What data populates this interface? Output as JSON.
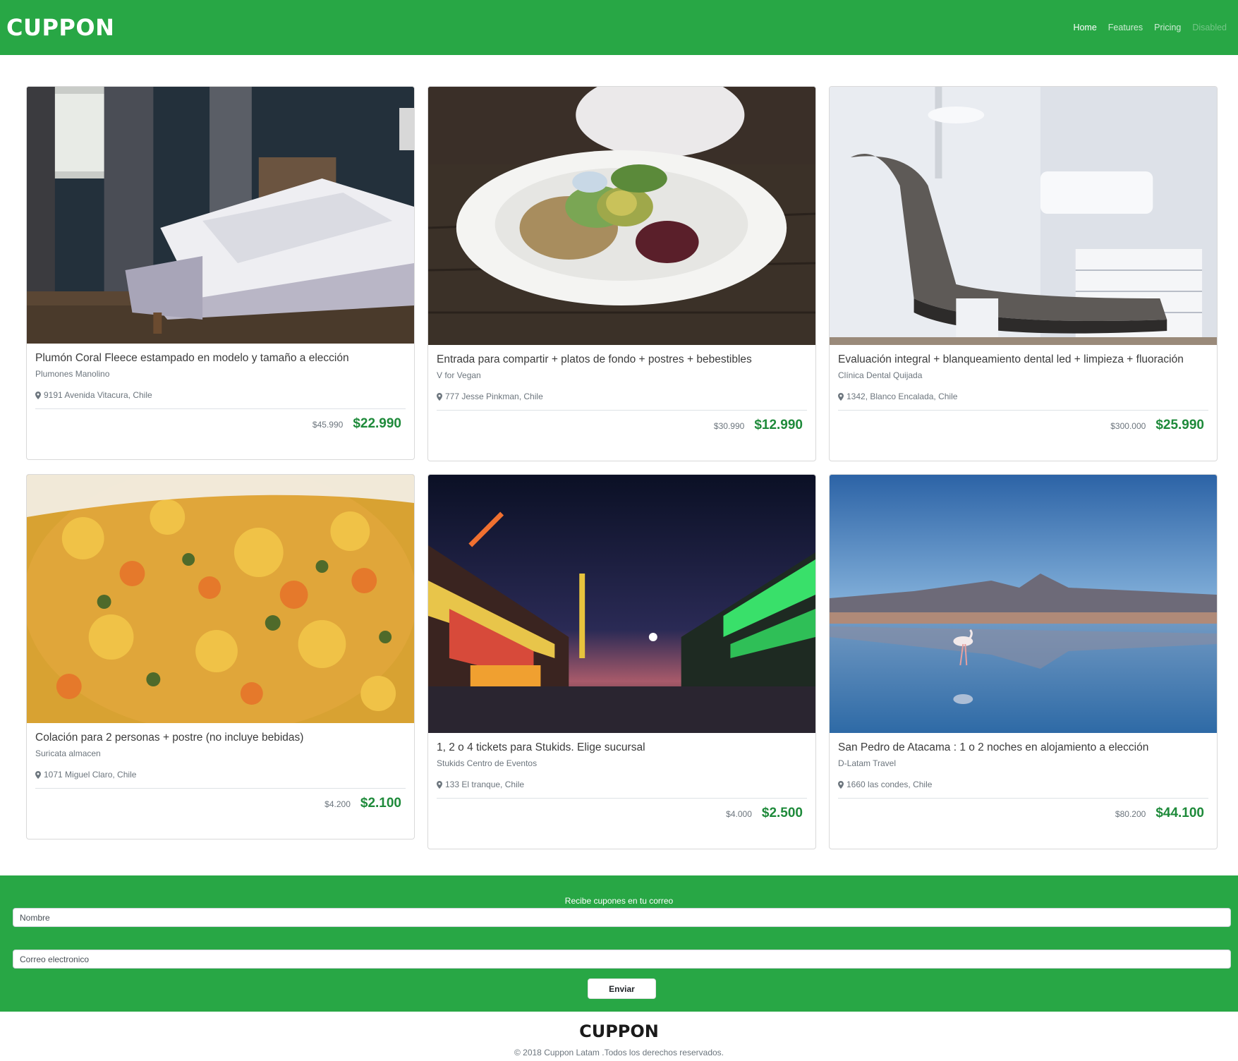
{
  "navbar": {
    "brand": "CUPPON",
    "links": [
      {
        "label": "Home",
        "state": "active"
      },
      {
        "label": "Features",
        "state": "normal"
      },
      {
        "label": "Pricing",
        "state": "normal"
      },
      {
        "label": "Disabled",
        "state": "disabled"
      }
    ]
  },
  "cards": [
    {
      "title": "Plumón Coral Fleece estampado en modelo y tamaño a elección",
      "seller": "Plumones Manolino",
      "location": "9191 Avenida Vitacura, Chile",
      "old_price": "$45.990",
      "new_price": "$22.990",
      "image": "bedroom-photo"
    },
    {
      "title": "Entrada para compartir + platos de fondo + postres + bebestibles",
      "seller": "V for Vegan",
      "location": "777 Jesse Pinkman, Chile",
      "old_price": "$30.990",
      "new_price": "$12.990",
      "image": "vegan-salad-photo"
    },
    {
      "title": "Evaluación integral + blanqueamiento dental led + limpieza + fluoración",
      "seller": "Clínica Dental Quijada",
      "location": "1342, Blanco Encalada, Chile",
      "old_price": "$300.000",
      "new_price": "$25.990",
      "image": "dental-chair-photo"
    },
    {
      "title": "Colación para 2 personas + postre (no incluye bebidas)",
      "seller": "Suricata almacen",
      "location": "1071 Miguel Claro, Chile",
      "old_price": "$4.200",
      "new_price": "$2.100",
      "image": "food-dish-photo"
    },
    {
      "title": "1, 2 o 4 tickets para Stukids. Elige sucursal",
      "seller": "Stukids Centro de Eventos",
      "location": "133 El tranque, Chile",
      "old_price": "$4.000",
      "new_price": "$2.500",
      "image": "fairground-photo"
    },
    {
      "title": "San Pedro de Atacama : 1 o 2 noches en alojamiento a elección",
      "seller": "D-Latam Travel",
      "location": "1660 las condes, Chile",
      "old_price": "$80.200",
      "new_price": "$44.100",
      "image": "flamingo-lake-photo"
    }
  ],
  "subscribe": {
    "title": "Recibe cupones en tu correo",
    "name_placeholder": "Nombre",
    "email_placeholder": "Correo electronico",
    "button": "Enviar"
  },
  "footer": {
    "brand": "CUPPON",
    "copyright": "© 2018 Cuppon Latam .Todos los derechos reservados."
  },
  "colors": {
    "brand_green": "#28a745",
    "price_green": "#1e8a3a"
  }
}
